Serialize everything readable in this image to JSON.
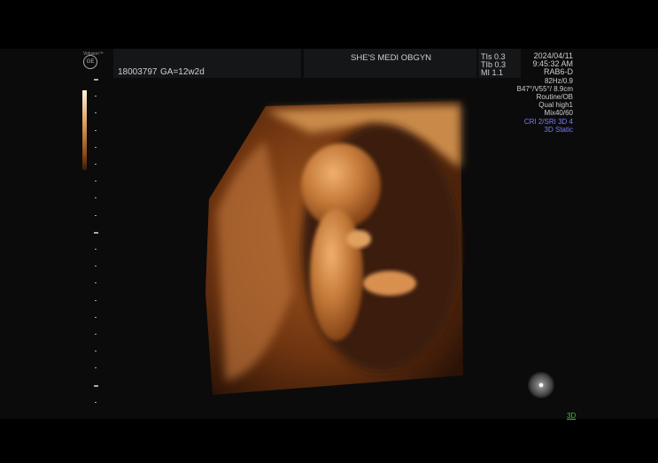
{
  "header": {
    "brand": "Voluson™",
    "logo": "GE",
    "patient_id": "18003797",
    "gestational_age": "GA=12w2d",
    "institution": "SHE'S MEDI OBGYN",
    "tis": "TIs  0.3",
    "tib": "TIb  0.3",
    "mi": "MI  1.1",
    "date": "2024/04/11",
    "time": "9:45:32 AM"
  },
  "params": [
    "RAB6-D",
    "82Hz/0.9",
    "B47°/V55°/ 8.9cm",
    "Routine/OB",
    "Qual high1",
    "Mix40/60"
  ],
  "mode_params": [
    "CRI 2/SRI 3D 4",
    "3D Static"
  ],
  "corner_label": "3D",
  "colors": {
    "accent_blue": "#7a7aff",
    "tint": "#b9702e",
    "green": "#3fbf3f"
  }
}
